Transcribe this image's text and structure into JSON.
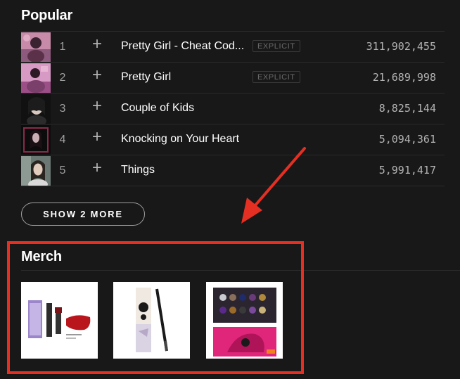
{
  "popular": {
    "title": "Popular",
    "tracks": [
      {
        "number": "1",
        "title": "Pretty Girl - Cheat Cod...",
        "explicit": "EXPLICIT",
        "plays": "311,902,455"
      },
      {
        "number": "2",
        "title": "Pretty Girl",
        "explicit": "EXPLICIT",
        "plays": "21,689,998"
      },
      {
        "number": "3",
        "title": "Couple of Kids",
        "explicit": "",
        "plays": "8,825,144"
      },
      {
        "number": "4",
        "title": "Knocking on Your Heart",
        "explicit": "",
        "plays": "5,094,361"
      },
      {
        "number": "5",
        "title": "Things",
        "explicit": "",
        "plays": "5,991,417"
      }
    ],
    "add_icon": "+",
    "show_more_label": "SHOW 2 MORE"
  },
  "merch": {
    "title": "Merch",
    "items": [
      {
        "icon": "lipstick-set-image"
      },
      {
        "icon": "eyeliner-pencil-image"
      },
      {
        "icon": "eyeshadow-palette-image"
      }
    ]
  },
  "colors": {
    "background": "#181818",
    "annotation": "#e52f22",
    "muted_text": "#b3b3b3"
  }
}
